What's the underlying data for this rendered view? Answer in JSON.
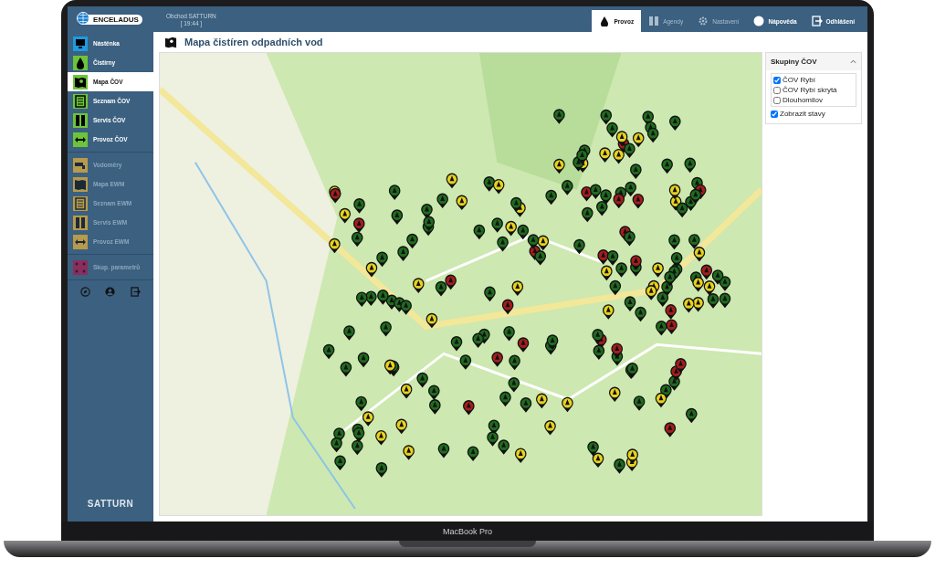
{
  "header": {
    "logo": "ENCELADUS",
    "shop": "Obchod SATTURN",
    "time": "[ 19:44 ]",
    "tabs": [
      {
        "label": "Provoz",
        "selected": true,
        "disabled": false
      },
      {
        "label": "Agendy",
        "selected": false,
        "disabled": true
      },
      {
        "label": "Nastavení",
        "selected": false,
        "disabled": true
      },
      {
        "label": "Nápověda",
        "selected": false,
        "disabled": false
      },
      {
        "label": "Odhlášení",
        "selected": false,
        "disabled": false
      }
    ]
  },
  "sidebar": {
    "groups": [
      {
        "items": [
          {
            "label": "Nástěnka",
            "selected": false,
            "disabled": false,
            "color": "#1e9be0"
          },
          {
            "label": "Čistírny",
            "selected": false,
            "disabled": false,
            "color": "#6cc43a"
          },
          {
            "label": "Mapa ČOV",
            "selected": true,
            "disabled": false,
            "color": "#6cc43a"
          },
          {
            "label": "Seznam ČOV",
            "selected": false,
            "disabled": false,
            "color": "#6cc43a"
          },
          {
            "label": "Servis ČOV",
            "selected": false,
            "disabled": false,
            "color": "#6cc43a"
          },
          {
            "label": "Provoz ČOV",
            "selected": false,
            "disabled": false,
            "color": "#6cc43a"
          }
        ]
      },
      {
        "items": [
          {
            "label": "Vodoměry",
            "selected": false,
            "disabled": true,
            "color": "#b79a4c"
          },
          {
            "label": "Mapa EWM",
            "selected": false,
            "disabled": true,
            "color": "#b79a4c"
          },
          {
            "label": "Seznam EWM",
            "selected": false,
            "disabled": true,
            "color": "#b79a4c"
          },
          {
            "label": "Servis EWM",
            "selected": false,
            "disabled": true,
            "color": "#b79a4c"
          },
          {
            "label": "Provoz EWM",
            "selected": false,
            "disabled": true,
            "color": "#b79a4c"
          }
        ]
      },
      {
        "items": [
          {
            "label": "Skup. parametrů",
            "selected": false,
            "disabled": true,
            "color": "#8a2e5e"
          }
        ]
      }
    ],
    "brand": "SATTURN"
  },
  "page": {
    "title": "Mapa čistíren odpadních vod"
  },
  "panel": {
    "title": "Skupiny ČOV",
    "expanded": true,
    "groups": [
      {
        "label": "ČOV Rybí",
        "checked": true
      },
      {
        "label": "ČOV Rybí skrytá",
        "checked": false
      },
      {
        "label": "Dlouhomilov",
        "checked": false
      }
    ],
    "show_states": {
      "label": "Zobrazit stavy",
      "checked": true
    }
  },
  "device": {
    "label": "MacBook Pro"
  }
}
